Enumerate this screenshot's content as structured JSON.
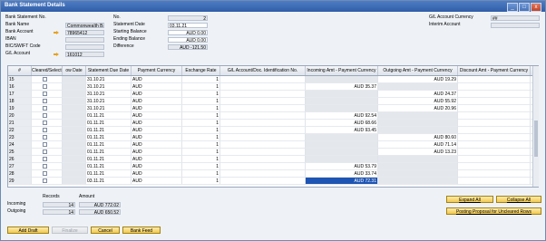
{
  "window": {
    "title": "Bank Statement Details",
    "buttons": [
      "_",
      "□",
      "x"
    ]
  },
  "header_left": {
    "bs_no_label": "Bank Statement No.",
    "bank_name_label": "Bank Name",
    "bank_name_value": "Commonwealth Ban",
    "bank_account_label": "Bank Account",
    "bank_account_value": "78965412",
    "iban_label": "IBAN",
    "bic_label": "BIC/SWIFT Code",
    "gl_account_label": "G/L Account",
    "gl_account_value": "161012"
  },
  "header_mid": {
    "no_label": "No.",
    "no_value": "2",
    "statement_date_label": "Statement Date",
    "statement_date_value": "03.11.21",
    "starting_balance_label": "Starting Balance",
    "starting_balance_value": "AUD 0.00",
    "ending_balance_label": "Ending Balance",
    "ending_balance_value": "AUD 0.00",
    "difference_label": "Difference",
    "difference_value": "AUD -121.50"
  },
  "header_right": {
    "gl_currency_label": "G/L Account Currency",
    "gl_currency_value": "##",
    "interim_label": "Interim Account"
  },
  "grid": {
    "columns": [
      "#",
      "Cleared/Selected",
      "ow Date",
      "Statement Due Date",
      "Payment Currency",
      "Exchange Rate",
      "G/L Account/Doc. Identification No.",
      "Incoming Amt - Payment Currency",
      "Outgoing Amt - Payment Currency",
      "Discount Amt - Payment Currency",
      "V"
    ],
    "rows": [
      {
        "no": "15",
        "due": "31.10.21",
        "cur": "AUD",
        "rate": "1",
        "in": "",
        "out": "AUD 19.29"
      },
      {
        "no": "16",
        "due": "31.10.21",
        "cur": "AUD",
        "rate": "1",
        "in": "AUD 35.37",
        "out": ""
      },
      {
        "no": "17",
        "due": "31.10.21",
        "cur": "AUD",
        "rate": "1",
        "in": "",
        "out": "AUD 24.37"
      },
      {
        "no": "18",
        "due": "31.10.21",
        "cur": "AUD",
        "rate": "1",
        "in": "",
        "out": "AUD 55.92"
      },
      {
        "no": "19",
        "due": "31.10.21",
        "cur": "AUD",
        "rate": "1",
        "in": "",
        "out": "AUD 20.96"
      },
      {
        "no": "20",
        "due": "01.11.21",
        "cur": "AUD",
        "rate": "1",
        "in": "AUD 92.54",
        "out": ""
      },
      {
        "no": "21",
        "due": "01.11.21",
        "cur": "AUD",
        "rate": "1",
        "in": "AUD 68.66",
        "out": ""
      },
      {
        "no": "22",
        "due": "01.11.21",
        "cur": "AUD",
        "rate": "1",
        "in": "AUD 93.45",
        "out": ""
      },
      {
        "no": "23",
        "due": "01.11.21",
        "cur": "AUD",
        "rate": "1",
        "in": "",
        "out": "AUD 80.60"
      },
      {
        "no": "24",
        "due": "01.11.21",
        "cur": "AUD",
        "rate": "1",
        "in": "",
        "out": "AUD 71.14"
      },
      {
        "no": "25",
        "due": "01.11.21",
        "cur": "AUD",
        "rate": "1",
        "in": "",
        "out": "AUD 13.23"
      },
      {
        "no": "26",
        "due": "01.11.21",
        "cur": "AUD",
        "rate": "1",
        "in": "",
        "out": ""
      },
      {
        "no": "27",
        "due": "01.11.21",
        "cur": "AUD",
        "rate": "1",
        "in": "AUD 53.79",
        "out": ""
      },
      {
        "no": "28",
        "due": "01.11.21",
        "cur": "AUD",
        "rate": "1",
        "in": "AUD 33.74",
        "out": ""
      },
      {
        "no": "29",
        "due": "03.11.21",
        "cur": "AUD",
        "rate": "1",
        "in": "AUD 72.31",
        "out": ""
      }
    ]
  },
  "summary": {
    "records_label": "Records",
    "amount_label": "Amount",
    "incoming_label": "Incoming",
    "incoming_records": "14",
    "incoming_amount": "AUD 772.02",
    "outgoing_label": "Outgoing",
    "outgoing_records": "14",
    "outgoing_amount": "AUD 650.52"
  },
  "right_buttons": {
    "expand_all": "Expand All",
    "collapse_all": "Collapse All",
    "posting_proposal": "Posting Proposal for Uncleared Rows"
  },
  "footer_buttons": {
    "add_draft": "Add Draft",
    "finalize": "Finalize",
    "cancel": "Cancel",
    "bank_feed": "Bank Feed"
  },
  "colors": {
    "title_bar": "#2f5ea8",
    "button_gold": "#f2c94c",
    "selection": "#1e55b3"
  }
}
